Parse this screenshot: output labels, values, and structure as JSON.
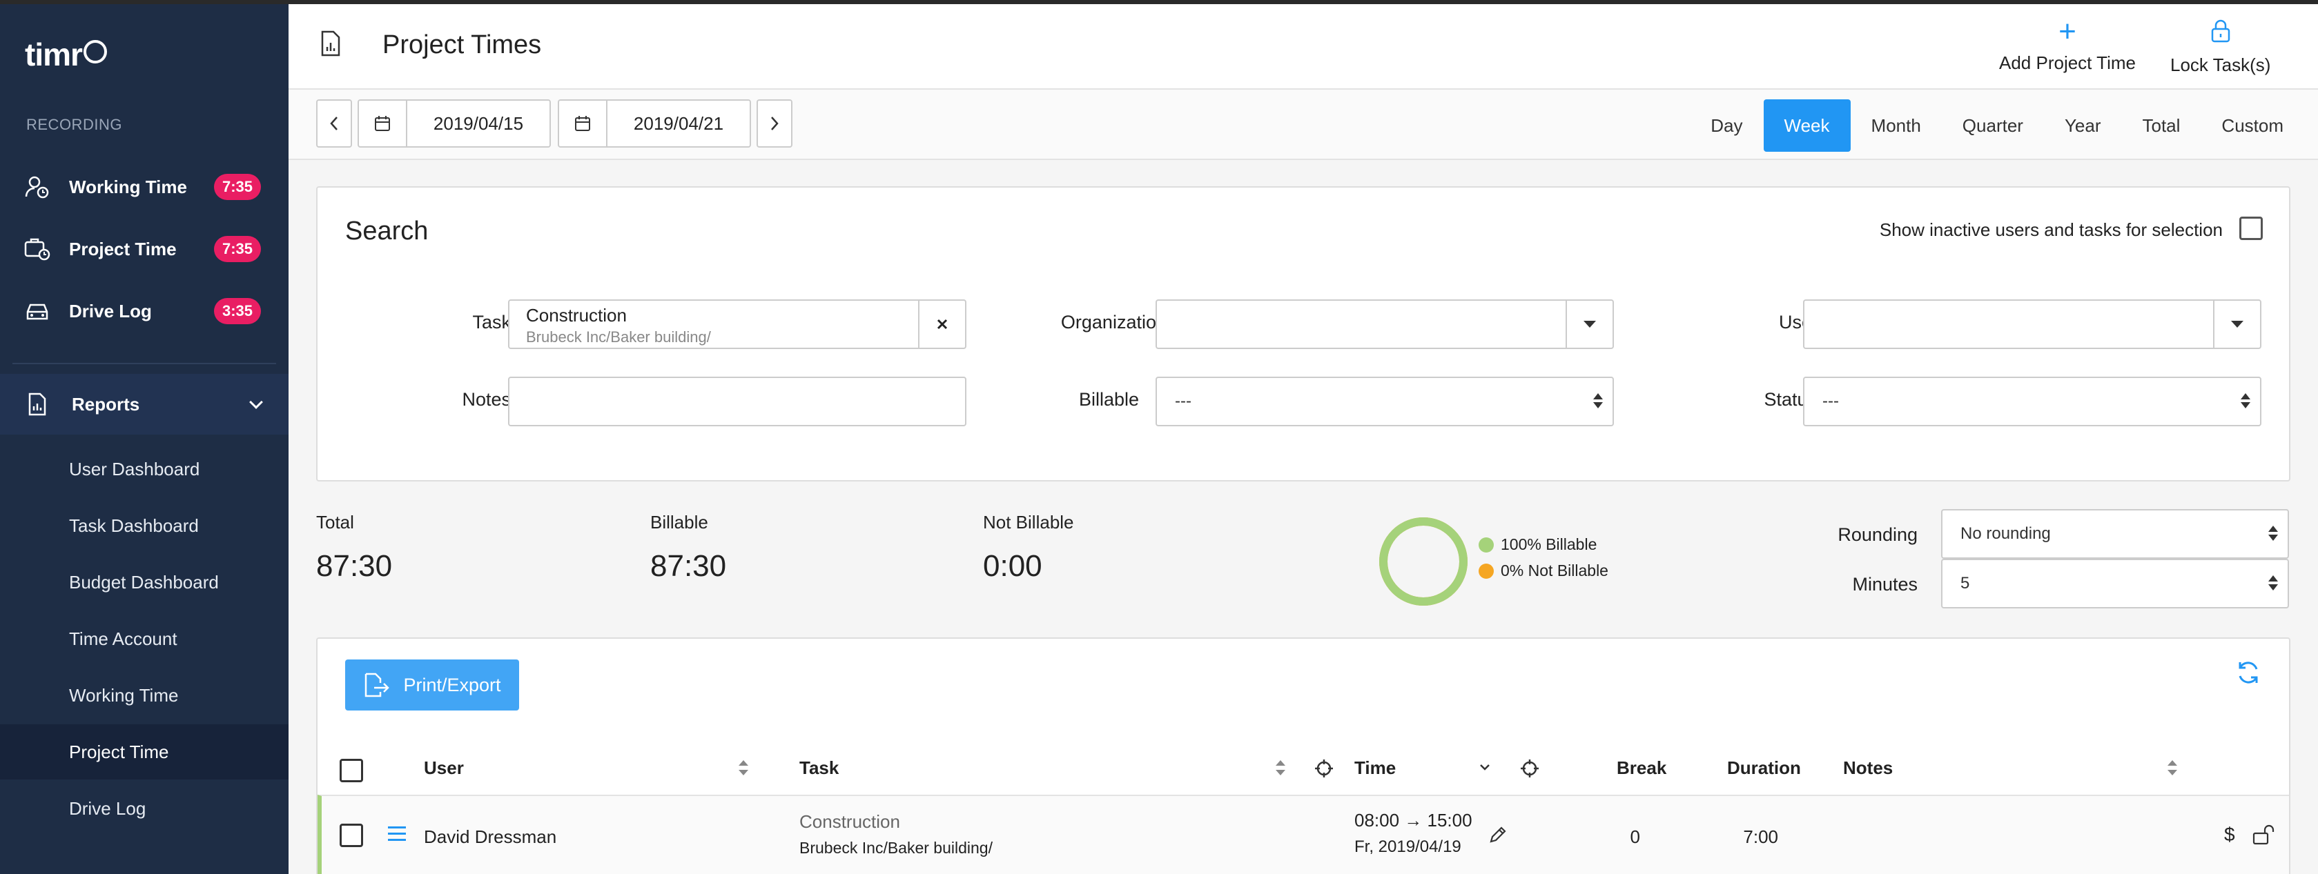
{
  "sidebar": {
    "logo": "timr",
    "section_label": "RECORDING",
    "recording_items": [
      {
        "label": "Working Time",
        "badge": "7:35",
        "icon": "user-clock-icon"
      },
      {
        "label": "Project Time",
        "badge": "7:35",
        "icon": "project-clock-icon"
      },
      {
        "label": "Drive Log",
        "badge": "3:35",
        "icon": "car-icon"
      }
    ],
    "reports": {
      "label": "Reports",
      "icon": "report-document-icon"
    },
    "report_items": [
      {
        "label": "User Dashboard"
      },
      {
        "label": "Task Dashboard"
      },
      {
        "label": "Budget Dashboard"
      },
      {
        "label": "Time Account"
      },
      {
        "label": "Working Time"
      },
      {
        "label": "Project Time",
        "active": true
      },
      {
        "label": "Drive Log"
      }
    ]
  },
  "header": {
    "title": "Project Times",
    "add_label": "Add Project Time",
    "lock_label": "Lock Task(s)"
  },
  "toolbar": {
    "start_date": "2019/04/15",
    "end_date": "2019/04/21",
    "periods": [
      "Day",
      "Week",
      "Month",
      "Quarter",
      "Year",
      "Total",
      "Custom"
    ],
    "active_period": "Week"
  },
  "search": {
    "title": "Search",
    "inactive_label": "Show inactive users and tasks for selection",
    "task_label": "Task",
    "task_value": "Construction",
    "task_path": "Brubeck Inc/Baker building/",
    "organization_label": "Organization",
    "user_label": "User",
    "notes_label": "Notes",
    "billable_label": "Billable",
    "billable_value": "---",
    "status_label": "Status",
    "status_value": "---"
  },
  "summary": {
    "total_label": "Total",
    "total_value": "87:30",
    "billable_label": "Billable",
    "billable_value": "87:30",
    "not_billable_label": "Not Billable",
    "not_billable_value": "0:00",
    "legend_billable": "100% Billable",
    "legend_not_billable": "0% Not Billable",
    "billable_fraction": 1.0,
    "colors": {
      "billable": "#a5d27a",
      "not_billable": "#f5a623"
    },
    "rounding_label": "Rounding",
    "rounding_value": "No rounding",
    "minutes_label": "Minutes",
    "minutes_value": "5"
  },
  "table": {
    "print_label": "Print/Export",
    "columns": {
      "user": "User",
      "task": "Task",
      "time": "Time",
      "break": "Break",
      "duration": "Duration",
      "notes": "Notes"
    },
    "rows": [
      {
        "user": "David Dressman",
        "task": "Construction",
        "task_path": "Brubeck Inc/Baker building/",
        "time_range": "08:00 → 15:00",
        "date": "Fr, 2019/04/19",
        "break": "0",
        "duration": "7:00"
      }
    ]
  }
}
